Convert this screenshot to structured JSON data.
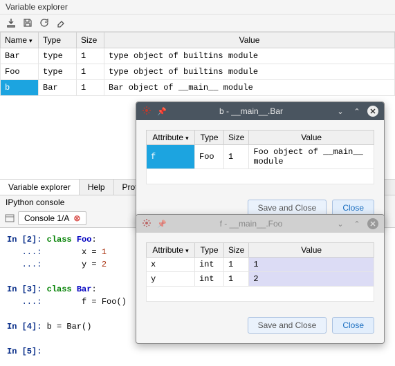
{
  "panel": {
    "title": "Variable explorer"
  },
  "columns": {
    "name": "Name",
    "type": "Type",
    "size": "Size",
    "value": "Value"
  },
  "vars": [
    {
      "name": "Bar",
      "type": "type",
      "size": "1",
      "value": "type object of builtins module"
    },
    {
      "name": "Foo",
      "type": "type",
      "size": "1",
      "value": "type object of builtins module"
    },
    {
      "name": "b",
      "type": "Bar",
      "size": "1",
      "value": "Bar object of __main__ module"
    }
  ],
  "lower_tabs": [
    "Variable explorer",
    "Help",
    "Profiler"
  ],
  "console": {
    "title": "IPython console",
    "tab": "Console 1/A"
  },
  "code": {
    "p2": "In [2]:",
    "p3": "In [3]:",
    "p4": "In [4]:",
    "p5": "In [5]:",
    "cont": "   ...:",
    "kw_class": "class",
    "foo": "Foo",
    "bar": "Bar",
    "colon": ":",
    "x_eq": "        x = ",
    "y_eq": "        y = ",
    "n1": "1",
    "n2": "2",
    "f_eq": "        f = Foo()",
    "b_eq": " b = Bar()"
  },
  "popup1": {
    "title": "b - __main__.Bar",
    "cols": {
      "attr": "Attribute",
      "type": "Type",
      "size": "Size",
      "value": "Value"
    },
    "rows": [
      {
        "attr": "f",
        "type": "Foo",
        "size": "1",
        "value": "Foo object of __main__ module"
      }
    ],
    "save": "Save and Close",
    "close": "Close"
  },
  "popup2": {
    "title": "f - __main__.Foo",
    "cols": {
      "attr": "Attribute",
      "type": "Type",
      "size": "Size",
      "value": "Value"
    },
    "rows": [
      {
        "attr": "x",
        "type": "int",
        "size": "1",
        "value": "1"
      },
      {
        "attr": "y",
        "type": "int",
        "size": "1",
        "value": "2"
      }
    ],
    "save": "Save and Close",
    "close": "Close"
  }
}
